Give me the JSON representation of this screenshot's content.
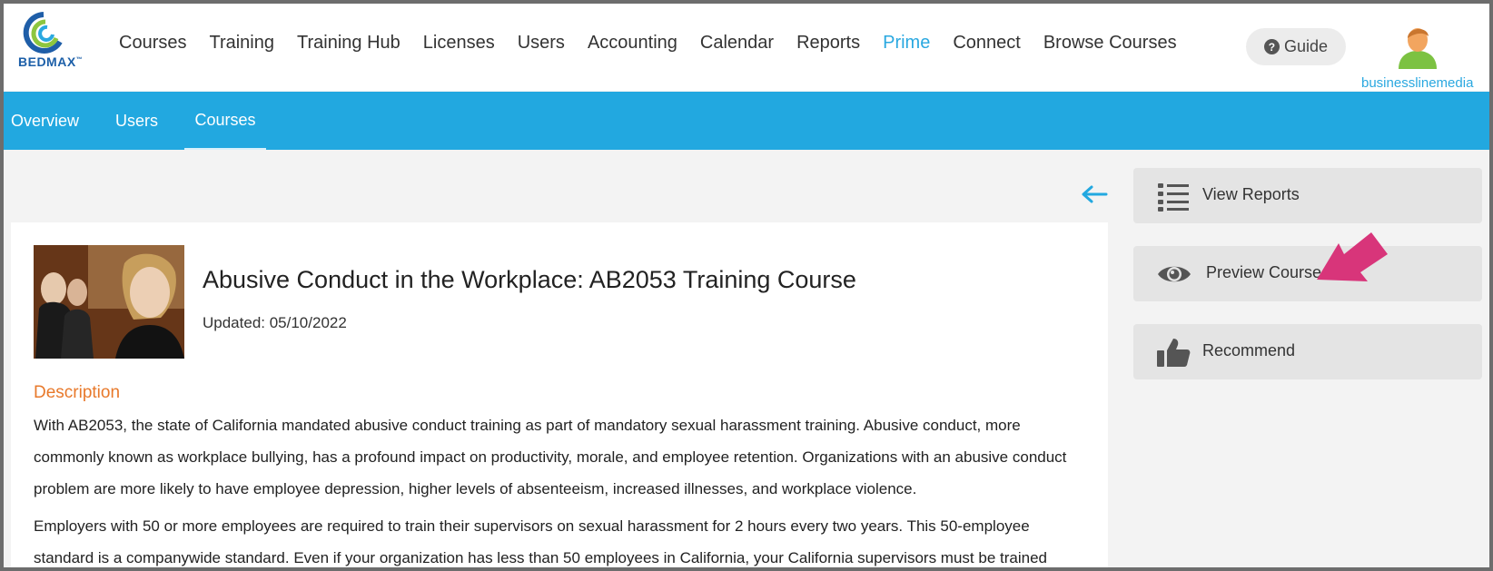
{
  "brand": {
    "logo_text": "BEDMAX",
    "trademark": "™"
  },
  "topnav": {
    "items": [
      {
        "label": "Courses",
        "active": false
      },
      {
        "label": "Training",
        "active": false
      },
      {
        "label": "Training Hub",
        "active": false
      },
      {
        "label": "Licenses",
        "active": false
      },
      {
        "label": "Users",
        "active": false
      },
      {
        "label": "Accounting",
        "active": false
      },
      {
        "label": "Calendar",
        "active": false
      },
      {
        "label": "Reports",
        "active": false
      },
      {
        "label": "Prime",
        "active": true
      },
      {
        "label": "Connect",
        "active": false
      },
      {
        "label": "Browse Courses",
        "active": false
      }
    ],
    "guide": {
      "icon": "?",
      "label": "Guide"
    },
    "user": {
      "name": "businesslinemedia",
      "icon": "user-avatar-icon"
    }
  },
  "subnav": {
    "items": [
      {
        "label": "Overview",
        "active": false
      },
      {
        "label": "Users",
        "active": false
      },
      {
        "label": "Courses",
        "active": true
      }
    ]
  },
  "course": {
    "title": "Abusive Conduct in the Workplace: AB2053 Training Course",
    "updated": "Updated: 05/10/2022",
    "description_heading": "Description",
    "paragraphs": [
      "With AB2053, the state of California mandated abusive conduct training as part of mandatory sexual harassment training. Abusive conduct, more commonly known as workplace bullying, has a profound impact on productivity, morale, and employee retention. Organizations with an abusive conduct problem are more likely to have employee depression, higher levels of absenteeism, increased illnesses, and workplace violence.",
      "Employers with 50 or more employees are required to train their supervisors on sexual harassment for 2 hours every two years. This 50-employee standard is a companywide standard. Even if your organization has less than 50 employees in California, your California supervisors must be trained"
    ]
  },
  "actions": {
    "view_reports": "View Reports",
    "preview_course": "Preview Course",
    "recommend": "Recommend"
  },
  "colors": {
    "accent": "#22a8e0",
    "heading_orange": "#e8792b",
    "annotation_pink": "#d8357a"
  }
}
